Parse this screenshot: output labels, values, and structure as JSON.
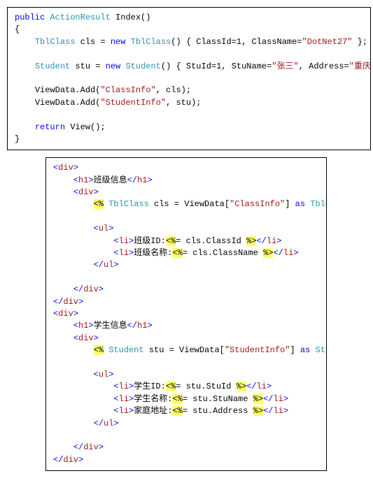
{
  "csharp": {
    "sig": {
      "kw_public": "public",
      "type_ar": "ActionResult",
      "name": " Index()"
    },
    "brace_open": "{",
    "l_cls": {
      "indent": "    ",
      "t1": "TblClass",
      "var": " cls = ",
      "kw_new": "new",
      "sp": " ",
      "t2": "TblClass",
      "mid": "() { ClassId=1, ClassName=",
      "s1": "\"DotNet27\"",
      "end": " };"
    },
    "l_stu": {
      "indent": "    ",
      "t1": "Student",
      "var": " stu = ",
      "kw_new": "new",
      "sp": " ",
      "t2": "Student",
      "mid": "() { StuId=1, StuName=",
      "s1": "\"张三\"",
      "mid2": ", Address=",
      "s2": "\"重庆市\"",
      "end": " };"
    },
    "vd1": {
      "indent": "    ",
      "pre": "ViewData.Add(",
      "s": "\"ClassInfo\"",
      "post": ", cls);"
    },
    "vd2": {
      "indent": "    ",
      "pre": "ViewData.Add(",
      "s": "\"StudentInfo\"",
      "post": ", stu);"
    },
    "ret": {
      "indent": "    ",
      "kw": "return",
      "post": " View();"
    },
    "brace_close": "}"
  },
  "htmlview": {
    "lt": "<",
    "gt": ">",
    "lts": "</",
    "div": "div",
    "h1": "h1",
    "ul": "ul",
    "li": "li",
    "h1_class": "班级信息",
    "h1_student": "学生信息",
    "cls_block": {
      "open": "<%",
      "sp": " ",
      "t": "TblClass",
      "mid": " cls = ViewData[",
      "s": "\"ClassInfo\"",
      "mid2": "] ",
      "kw_as": "as",
      "sp2": " ",
      "t2": "TblClass",
      "end": "; ",
      "close": "%>"
    },
    "li_cls1": {
      "label": "班级ID:",
      "open": "<%",
      "expr": "= cls.ClassId ",
      "close": "%>"
    },
    "li_cls2": {
      "label": "班级名称:",
      "open": "<%",
      "expr": "= cls.ClassName ",
      "close": "%>"
    },
    "stu_block": {
      "open": "<%",
      "sp": " ",
      "t": "Student",
      "mid": " stu = ViewData[",
      "s": "\"StudentInfo\"",
      "mid2": "] ",
      "kw_as": "as",
      "sp2": " ",
      "t2": "Student",
      "end": "; ",
      "close": "%>"
    },
    "li_stu1": {
      "label": "学生ID:",
      "open": "<%",
      "expr": "= stu.StuId ",
      "close": "%>"
    },
    "li_stu2": {
      "label": "学生名称:",
      "open": "<%",
      "expr": "= stu.StuName ",
      "close": "%>"
    },
    "li_stu3": {
      "label": "家庭地址:",
      "open": "<%",
      "expr": "= stu.Address ",
      "close": "%>"
    }
  }
}
